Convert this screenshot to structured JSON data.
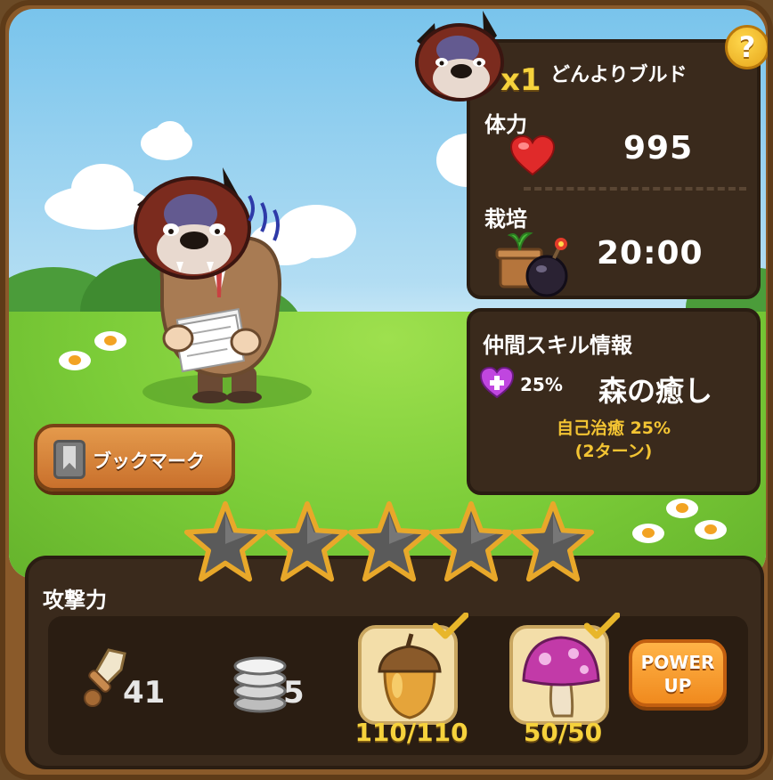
{
  "monster": {
    "name": "どんよりブルド",
    "count": "x1"
  },
  "stats": {
    "hp_label": "体力",
    "hp_value": "995",
    "grow_label": "栽培",
    "grow_value": "20:00"
  },
  "skill": {
    "header": "仲間スキル情報",
    "percent": "25%",
    "name": "森の癒し",
    "desc_line1": "自己治癒 25%",
    "desc_line2": "(2ターン)"
  },
  "help": {
    "label": "?"
  },
  "bookmark": {
    "label": "ブックマーク"
  },
  "stars": {
    "filled": 0,
    "total": 5
  },
  "attack": {
    "label": "攻撃力",
    "sword_value": "41",
    "coin_value": "5",
    "acorn_value": "110/110",
    "mushroom_value": "50/50"
  },
  "powerup": {
    "line1": "POWER",
    "line2": "UP"
  },
  "colors": {
    "panel": "#3a2a1c",
    "accent_yellow": "#f6d23c",
    "heart": "#e02a2a",
    "skill_heart": "#c046e0"
  }
}
